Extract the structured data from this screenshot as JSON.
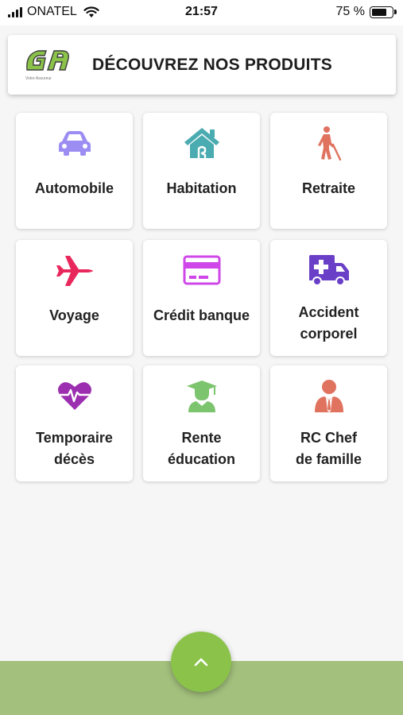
{
  "status_bar": {
    "carrier": "ONATEL",
    "time": "21:57",
    "battery": "75 %",
    "battery_level": 0.75
  },
  "header": {
    "title": "DÉCOUVREZ NOS PRODUITS",
    "logo_icon": "company-logo"
  },
  "products": [
    {
      "label": "Automobile",
      "icon": "car-icon",
      "color": "#9b8df2"
    },
    {
      "label": "Habitation",
      "icon": "house-icon",
      "color": "#4aabb0"
    },
    {
      "label": "Retraite",
      "icon": "elderly-person-icon",
      "color": "#e0735f"
    },
    {
      "label": "Voyage",
      "icon": "airplane-icon",
      "color": "#e8285c"
    },
    {
      "label": "Crédit banque",
      "icon": "credit-card-icon",
      "color": "#cf47e8"
    },
    {
      "label": "Accident corporel",
      "line1": "Accident",
      "line2": "corporel",
      "icon": "ambulance-icon",
      "color": "#6a3fc8"
    },
    {
      "label": "Temporaire décès",
      "line1": "Temporaire",
      "line2": "décès",
      "icon": "heartbeat-icon",
      "color": "#9b2fb0"
    },
    {
      "label": "Rente éducation",
      "line1": "Rente",
      "line2": "éducation",
      "icon": "graduate-icon",
      "color": "#7cc46d"
    },
    {
      "label": "RC Chef de famille",
      "line1": "RC Chef",
      "line2": "de famille",
      "icon": "businessman-icon",
      "color": "#e0735f"
    }
  ],
  "fab": {
    "icon": "chevron-up-icon",
    "color": "#8bc34a"
  },
  "bottom_bar": {
    "color": "#a3c07d"
  }
}
